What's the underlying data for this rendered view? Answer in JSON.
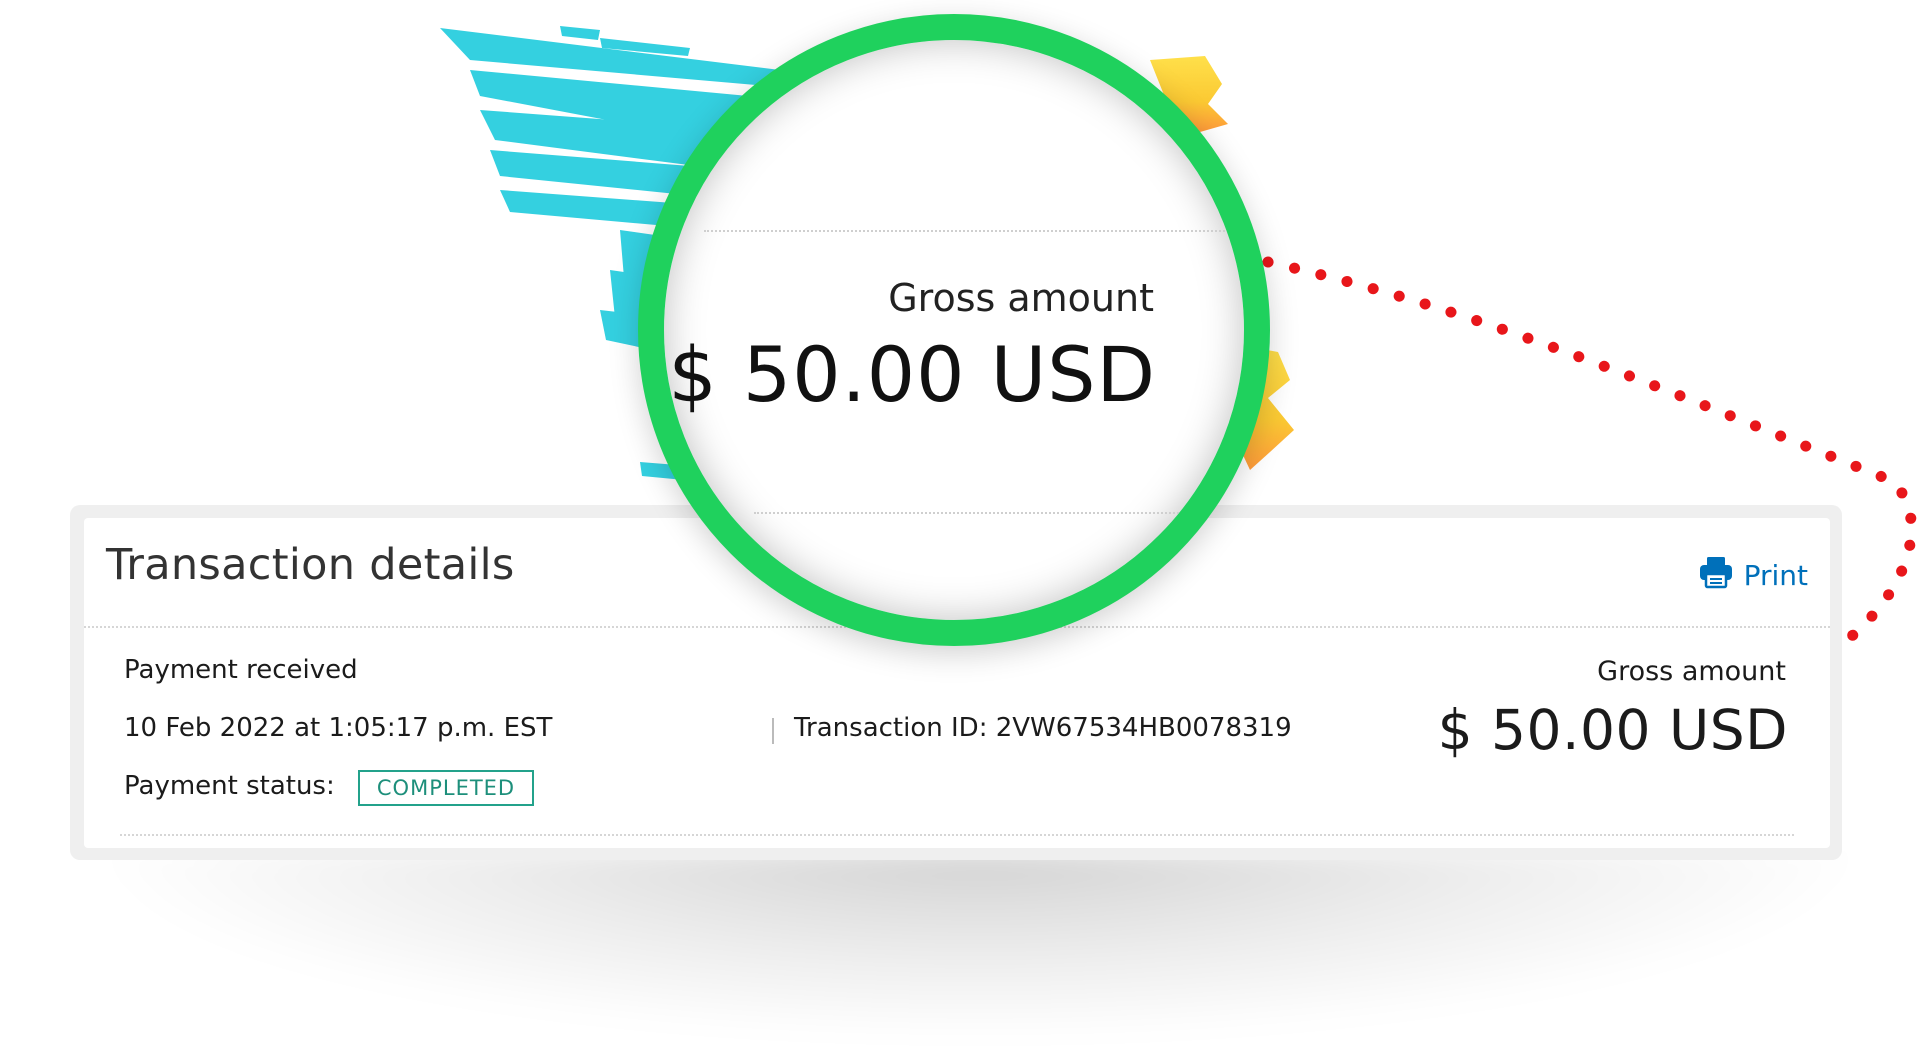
{
  "colors": {
    "accent_link": "#0070ba",
    "status_green": "#23a28b",
    "magnifier_ring": "#1fd15d",
    "connector_dots": "#e8161a",
    "brush_cyan": "#34d0e0",
    "brush_yellow": "#fbd234",
    "brush_magenta": "#ee3fd6"
  },
  "icons": {
    "print": "printer-icon"
  },
  "card": {
    "title": "Transaction details",
    "print_label": "Print",
    "payment_type": "Payment received",
    "timestamp": "10 Feb 2022 at 1:05:17 p.m. EST",
    "transaction_id": "Transaction ID: 2VW67534HB0078319",
    "status_label": "Payment status:",
    "status_value": "COMPLETED",
    "gross_label": "Gross amount",
    "gross_value": "$ 50.00 USD"
  },
  "magnifier": {
    "gross_label": "Gross amount",
    "gross_value": "$ 50.00 USD"
  }
}
